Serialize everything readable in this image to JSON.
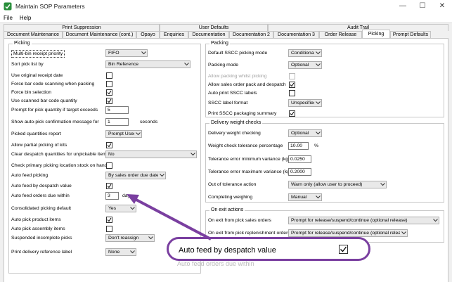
{
  "window": {
    "title": "Maintain SOP Parameters",
    "minimize": "—",
    "maximize": "☐",
    "close": "✕"
  },
  "menu": [
    "File",
    "Help"
  ],
  "tabs_top": [
    "Print Suppression",
    "User Defaults",
    "Audit Trail"
  ],
  "tabs_bottom": [
    "Document Maintenance",
    "Document Maintenance (cont.)",
    "Opayo",
    "Enquiries",
    "Documentation",
    "Documentation 2",
    "Documentation 3",
    "Order Release",
    "Picking",
    "Prompt Defaults"
  ],
  "picking": {
    "title": "Picking",
    "multi_bin": {
      "label": "Multi-bin receipt priority",
      "value": "FIFO"
    },
    "sort_pick_list": {
      "label": "Sort pick list by",
      "value": "Bin Reference"
    },
    "use_original_receipt_date": {
      "label": "Use original receipt date",
      "checked": false
    },
    "force_bar_code": {
      "label": "Force bar code scanning when packing",
      "checked": false
    },
    "force_bin": {
      "label": "Force bin selection",
      "checked": true
    },
    "use_scanned_bar_code": {
      "label": "Use scanned bar code quantity",
      "checked": true
    },
    "prompt_pick_qty": {
      "label": "Prompt for pick quantity if target exceeds",
      "value": "5"
    },
    "auto_pick_confirm": {
      "label": "Show auto-pick confirmation message for",
      "value": "1",
      "unit": "seconds"
    },
    "picked_qty_report": {
      "label": "Picked quantities report",
      "value": "Prompt User"
    },
    "allow_partial": {
      "label": "Allow partial picking of kits",
      "checked": true
    },
    "clear_despatch": {
      "label": "Clear despatch quantities for unpickable items",
      "value": "No"
    },
    "check_primary": {
      "label": "Check primary picking location stock on hand",
      "checked": false
    },
    "auto_feed_picking": {
      "label": "Auto feed picking",
      "value": "By sales order due date"
    },
    "auto_feed_despatch": {
      "label": "Auto feed by despatch value",
      "checked": true
    },
    "auto_feed_orders_due": {
      "label": "Auto feed orders due within",
      "value": "3",
      "unit": "days"
    },
    "consolidated": {
      "label": "Consolidated picking default",
      "value": "Yes"
    },
    "auto_pick_product": {
      "label": "Auto pick product items",
      "checked": true
    },
    "auto_pick_assembly": {
      "label": "Auto pick assembly items",
      "checked": false
    },
    "suspended_incomplete": {
      "label": "Suspended incomplete picks",
      "value": "Don't reassign"
    },
    "print_delivery_ref": {
      "label": "Print delivery reference label",
      "value": "None"
    }
  },
  "packing": {
    "title": "Packing",
    "default_sscc": {
      "label": "Default SSCC picking mode",
      "value": "Conditional"
    },
    "packing_mode": {
      "label": "Packing mode",
      "value": "Optional"
    },
    "allow_packing_whilst": {
      "label": "Allow packing whilst picking",
      "checked": false
    },
    "allow_sales_order_pack": {
      "label": "Allow sales order pack and despatch",
      "checked": true
    },
    "auto_print_sscc": {
      "label": "Auto print SSCC labels",
      "checked": false
    },
    "sscc_label_format": {
      "label": "SSCC label format",
      "value": "Unspecified"
    },
    "print_sscc_summary": {
      "label": "Print SSCC packaging summary",
      "checked": true
    }
  },
  "weight": {
    "title": "Delivery weight checks",
    "delivery_weight_checking": {
      "label": "Delivery weight checking",
      "value": "Optional"
    },
    "tolerance_pct": {
      "label": "Weight check tolerance percentage",
      "value": "10.00",
      "unit": "%"
    },
    "tol_min": {
      "label": "Tolerance error minimum variance (kg)",
      "value": "0.0250"
    },
    "tol_max": {
      "label": "Tolerance error maximum variance (kg)",
      "value": "0.2000"
    },
    "out_of_tolerance": {
      "label": "Out of tolerance action",
      "value": "Warn only (allow user to proceed)"
    },
    "completing_weighing": {
      "label": "Completing weighing",
      "value": "Manual"
    }
  },
  "exit": {
    "title": "On exit actions",
    "exit_sales": {
      "label": "On exit from pick sales orders",
      "value": "Prompt for release/suspend/continue (optional release)"
    },
    "exit_replenish": {
      "label": "On exit from pick replenishment orders",
      "value": "Prompt for release/suspend/continue (optional release)"
    }
  },
  "callout": {
    "label": "Auto feed by despatch value",
    "checked": true,
    "ghost_text": "Auto feed orders due within"
  },
  "colors": {
    "callout_border": "#7a3fa0",
    "panel_border": "#c4c4c4"
  }
}
